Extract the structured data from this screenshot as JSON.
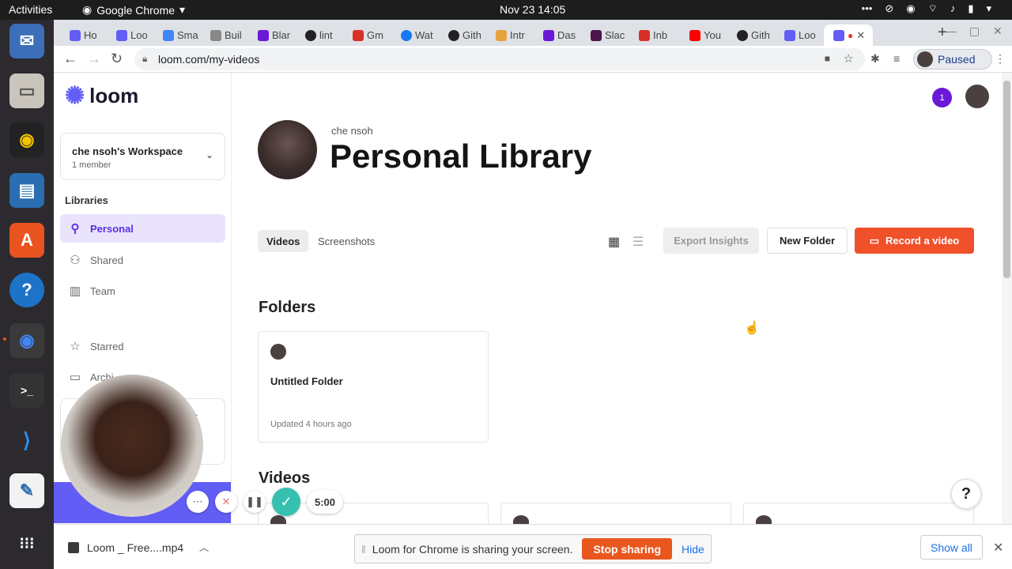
{
  "os": {
    "activities": "Activities",
    "app_name": "Google Chrome",
    "clock": "Nov 23  14:05"
  },
  "browser": {
    "tabs": [
      {
        "label": "Ho",
        "color": "#625df5"
      },
      {
        "label": "Loo",
        "color": "#625df5"
      },
      {
        "label": "Sma",
        "color": "#4285f4"
      },
      {
        "label": "Buil",
        "color": "#888888"
      },
      {
        "label": "Blar",
        "color": "#6b18d8"
      },
      {
        "label": "lint",
        "color": "#222222"
      },
      {
        "label": "Gm",
        "color": "#d93025"
      },
      {
        "label": "Wat",
        "color": "#1877f2"
      },
      {
        "label": "Gith",
        "color": "#222222"
      },
      {
        "label": "Intr",
        "color": "#e8a33d"
      },
      {
        "label": "Das",
        "color": "#6b18d8"
      },
      {
        "label": "Slac",
        "color": "#4a154b"
      },
      {
        "label": "Inb",
        "color": "#d93025"
      },
      {
        "label": "You",
        "color": "#ff0000"
      },
      {
        "label": "Gith",
        "color": "#222222"
      },
      {
        "label": "Loo",
        "color": "#625df5"
      }
    ],
    "url": "loom.com/my-videos",
    "profile_status": "Paused"
  },
  "sidebar": {
    "brand": "loom",
    "workspace": {
      "name": "che nsoh's Workspace",
      "members": "1 member"
    },
    "libraries_heading": "Libraries",
    "items": [
      {
        "label": "Personal",
        "icon": "person-icon"
      },
      {
        "label": "Shared",
        "icon": "people-icon"
      },
      {
        "label": "Team",
        "icon": "building-icon"
      }
    ],
    "starred": "Starred",
    "archive": "Archi",
    "upsell_text": "m."
  },
  "header": {
    "notification_count": "1",
    "owner": "che nsoh",
    "title": "Personal Library"
  },
  "toolbar": {
    "tabs": [
      "Videos",
      "Screenshots"
    ],
    "export": "Export Insights",
    "new_folder": "New Folder",
    "record": "Record a video"
  },
  "folders": {
    "heading": "Folders",
    "items": [
      {
        "name": "Untitled Folder",
        "updated": "Updated 4 hours ago"
      }
    ]
  },
  "videos": {
    "heading": "Videos"
  },
  "recorder": {
    "timer": "5:00"
  },
  "download_bar": {
    "file": "Loom _ Free....mp4",
    "share_message": "Loom for Chrome is sharing your screen.",
    "stop_sharing": "Stop sharing",
    "hide": "Hide",
    "show_all": "Show all"
  },
  "colors": {
    "brand_purple": "#625df5",
    "record_orange": "#f0512b",
    "active_nav_bg": "#e9e4fb"
  }
}
